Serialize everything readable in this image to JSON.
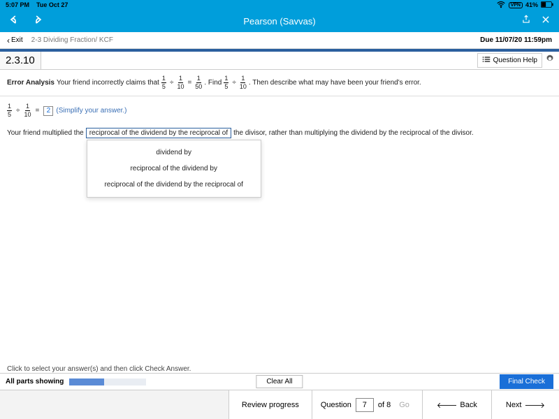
{
  "status": {
    "time": "5:07 PM",
    "date": "Tue Oct 27",
    "vpn": "VPN",
    "battery": "41%"
  },
  "header": {
    "title": "Pearson (Savvas)"
  },
  "subheader": {
    "exit": "Exit",
    "assignment": "2-3 Dividing Fraction/ KCF",
    "due": "Due 11/07/20 11:59pm"
  },
  "qbar": {
    "number": "2.3.10",
    "help": "Question Help"
  },
  "prompt": {
    "label": "Error Analysis",
    "text1": "Your friend incorrectly claims that",
    "f1n": "1",
    "f1d": "5",
    "div": "÷",
    "f2n": "1",
    "f2d": "10",
    "eq": "=",
    "f3n": "1",
    "f3d": "50",
    "text2": ". Find",
    "f4n": "1",
    "f4d": "5",
    "f5n": "1",
    "f5d": "10",
    "text3": ". Then describe what may have been your friend's error."
  },
  "answer": {
    "f1n": "1",
    "f1d": "5",
    "div": "÷",
    "f2n": "1",
    "f2d": "10",
    "eq": "=",
    "value": "2",
    "hint": "(Simplify your answer.)"
  },
  "sentence": {
    "pre": "Your friend multiplied the",
    "selected": "reciprocal of the dividend by the reciprocal of",
    "post": "the divisor, rather than multiplying the dividend by the reciprocal of the divisor.",
    "options": [
      "dividend by",
      "reciprocal of the dividend by",
      "reciprocal of the dividend by the reciprocal of"
    ]
  },
  "instruct": "Click to select your answer(s) and then click Check Answer.",
  "progress": {
    "label": "All parts showing",
    "clear": "Clear All",
    "final": "Final Check"
  },
  "footer": {
    "review": "Review progress",
    "question_label": "Question",
    "current": "7",
    "total": "of 8",
    "go": "Go",
    "back": "Back",
    "next": "Next"
  }
}
